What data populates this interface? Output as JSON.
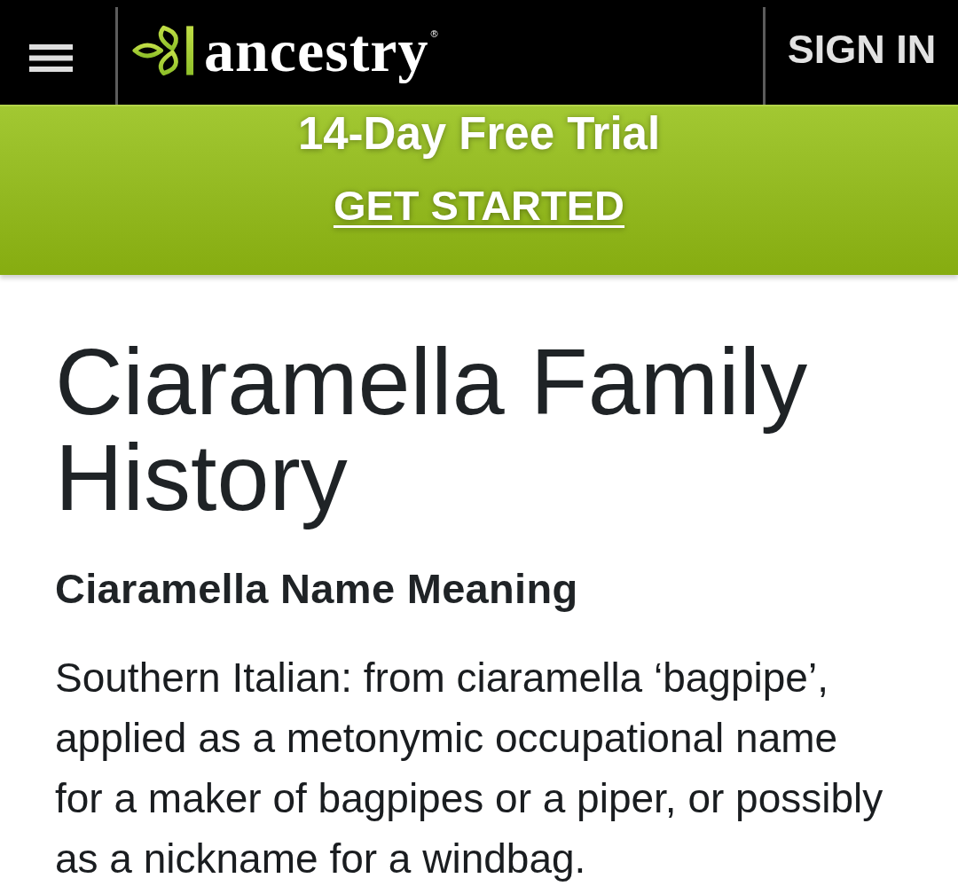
{
  "header": {
    "logo": {
      "text": "ancestry",
      "mark": "®"
    },
    "sign_in": "SIGN IN"
  },
  "promo_banner": {
    "title": "14-Day Free Trial",
    "link": "GET STARTED"
  },
  "page": {
    "title": "Ciaramella Family History",
    "sections": [
      {
        "heading": "Ciaramella Name Meaning",
        "body": "Southern Italian: from ciaramella ‘bagpipe’, applied as a metonymic occupational name for a maker of bagpipes or a piper, or possibly as a nickname for a windbag."
      }
    ]
  }
}
